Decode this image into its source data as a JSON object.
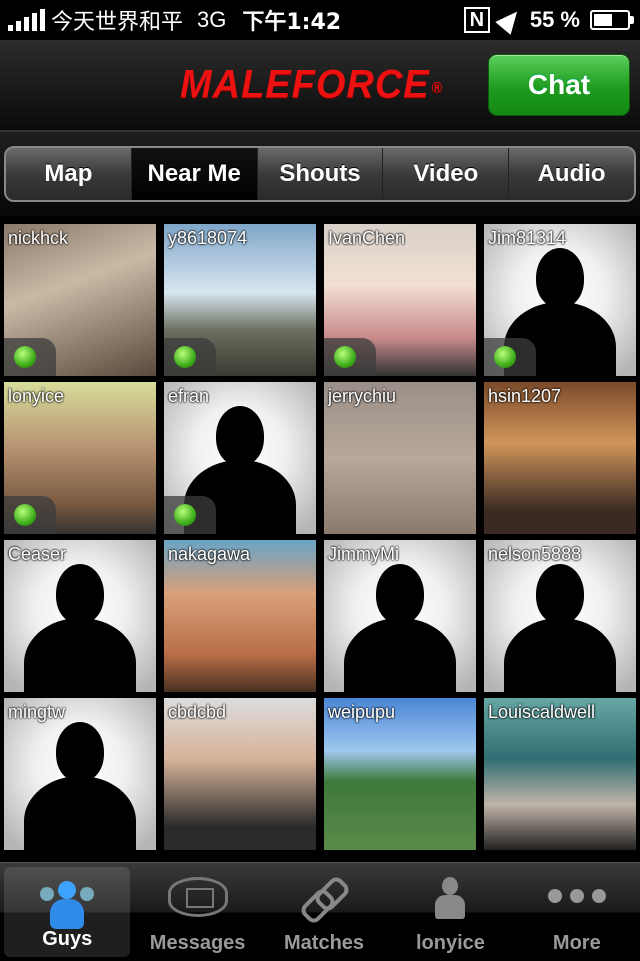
{
  "status_bar": {
    "carrier": "今天世界和平",
    "network": "3G",
    "time": "下午1:42",
    "battery": "55 %",
    "battery_level": 0.55
  },
  "header": {
    "logo": "MALEFORCE",
    "logo_mark": "®",
    "chat_button": "Chat"
  },
  "segments": [
    "Map",
    "Near Me",
    "Shouts",
    "Video",
    "Audio"
  ],
  "selected_segment": "Near Me",
  "users": [
    {
      "name": "nickhck",
      "online": true,
      "photo": "photo"
    },
    {
      "name": "y8618074",
      "online": true,
      "photo": "photo"
    },
    {
      "name": "IvanChen",
      "online": true,
      "photo": "photo"
    },
    {
      "name": "Jim81314",
      "online": true,
      "photo": "silhouette"
    },
    {
      "name": "lonyice",
      "online": true,
      "photo": "photo"
    },
    {
      "name": "efran",
      "online": true,
      "photo": "silhouette"
    },
    {
      "name": "jerrychiu",
      "online": false,
      "photo": "photo"
    },
    {
      "name": "hsin1207",
      "online": false,
      "photo": "photo"
    },
    {
      "name": "Ceaser",
      "online": false,
      "photo": "silhouette"
    },
    {
      "name": "nakagawa",
      "online": false,
      "photo": "photo"
    },
    {
      "name": "JimmyMi",
      "online": false,
      "photo": "silhouette"
    },
    {
      "name": "nelson5888",
      "online": false,
      "photo": "silhouette"
    },
    {
      "name": "mingtw",
      "online": false,
      "photo": "silhouette"
    },
    {
      "name": "cbdcbd",
      "online": false,
      "photo": "photo"
    },
    {
      "name": "weipupu",
      "online": false,
      "photo": "photo"
    },
    {
      "name": "Louiscaldwell",
      "online": false,
      "photo": "photo"
    }
  ],
  "tabbar": {
    "guys": "Guys",
    "messages": "Messages",
    "matches": "Matches",
    "profile": "lonyice",
    "more": "More"
  },
  "colors": {
    "brand_red": "#e11111",
    "chat_green": "#1f9a1f",
    "online_green": "#3fae1a"
  }
}
